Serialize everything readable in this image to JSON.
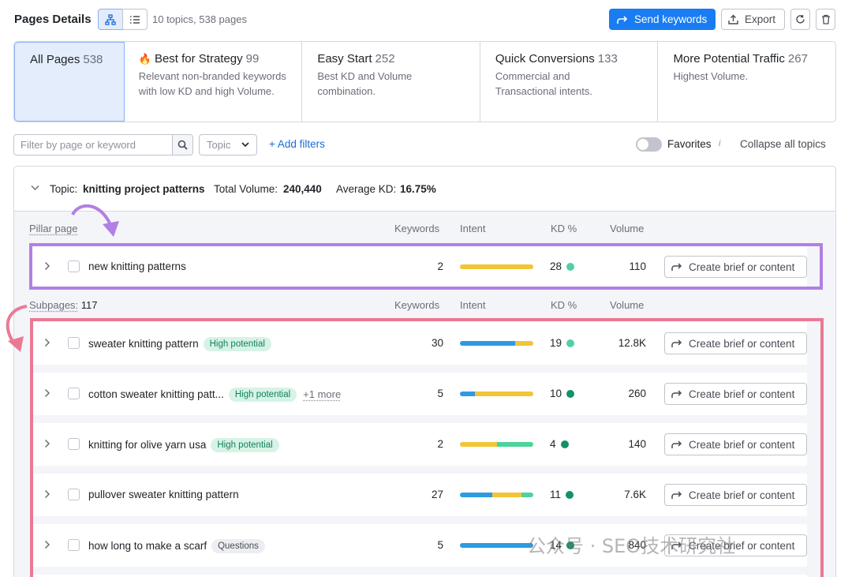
{
  "header": {
    "title": "Pages Details",
    "summary": "10 topics, 538 pages",
    "send_label": "Send keywords",
    "export_label": "Export"
  },
  "strategies": [
    {
      "title": "All Pages",
      "count": "538",
      "desc": ""
    },
    {
      "title": "Best for Strategy",
      "count": "99",
      "desc": "Relevant non-branded keywords with low KD and high Volume."
    },
    {
      "title": "Easy Start",
      "count": "252",
      "desc": "Best KD and Volume combination."
    },
    {
      "title": "Quick Conversions",
      "count": "133",
      "desc": "Commercial and Transactional intents."
    },
    {
      "title": "More Potential Traffic",
      "count": "267",
      "desc": "Highest Volume."
    }
  ],
  "filters": {
    "search_placeholder": "Filter by page or keyword",
    "topic_label": "Topic",
    "add_filters": "+ Add filters",
    "favorites_label": "Favorites",
    "collapse_label": "Collapse all topics",
    "info_glyph": "i"
  },
  "topic": {
    "prefix": "Topic:",
    "name": "knitting project patterns",
    "volume_label": "Total Volume:",
    "volume": "240,440",
    "kd_label": "Average KD:",
    "kd": "16.75%"
  },
  "columns": {
    "pillar": "Pillar page",
    "subpages": "Subpages:",
    "subpages_count": "117",
    "keywords": "Keywords",
    "intent": "Intent",
    "kd": "KD %",
    "volume": "Volume"
  },
  "action_label": "Create brief or content",
  "pillar_row": {
    "keyword": "new knitting patterns",
    "keywords": "2",
    "kd": "28",
    "volume": "110",
    "intent": [
      {
        "color": "#f2c438",
        "value": 1.0
      }
    ],
    "kd_color": "#4fd1a1"
  },
  "subpage_rows": [
    {
      "keyword": "sweater knitting pattern",
      "badge": "High potential",
      "more": "",
      "keywords": "30",
      "kd": "19",
      "volume": "12.8K",
      "kd_color": "#4fd1a1",
      "intent": [
        {
          "color": "#2e9be0",
          "value": 0.75
        },
        {
          "color": "#f2c438",
          "value": 0.25
        }
      ]
    },
    {
      "keyword": "cotton sweater knitting patt...",
      "badge": "High potential",
      "more": "+1 more",
      "keywords": "5",
      "kd": "10",
      "volume": "260",
      "kd_color": "#12916a",
      "intent": [
        {
          "color": "#2e9be0",
          "value": 0.2
        },
        {
          "color": "#f2c438",
          "value": 0.8
        }
      ]
    },
    {
      "keyword": "knitting for olive yarn usa",
      "badge": "High potential",
      "more": "",
      "keywords": "2",
      "kd": "4",
      "volume": "140",
      "kd_color": "#12916a",
      "intent": [
        {
          "color": "#f2c438",
          "value": 0.5
        },
        {
          "color": "#4cd39b",
          "value": 0.5
        }
      ]
    },
    {
      "keyword": "pullover sweater knitting pattern",
      "badge": "",
      "more": "",
      "keywords": "27",
      "kd": "11",
      "volume": "7.6K",
      "kd_color": "#12916a",
      "intent": [
        {
          "color": "#2e9be0",
          "value": 0.44
        },
        {
          "color": "#f2c438",
          "value": 0.4
        },
        {
          "color": "#4cd39b",
          "value": 0.16
        }
      ]
    },
    {
      "keyword": "how long to make a scarf",
      "badge": "Questions",
      "more": "",
      "keywords": "5",
      "kd": "14",
      "volume": "840",
      "kd_color": "#12916a",
      "intent": [
        {
          "color": "#2e9be0",
          "value": 1.0
        }
      ]
    }
  ],
  "watermark": "公众号 · SEO技术研究社",
  "colors": {
    "accent": "#1a7cf2",
    "pillar_box": "#b27fe4",
    "subpage_box": "#ea7a94"
  }
}
